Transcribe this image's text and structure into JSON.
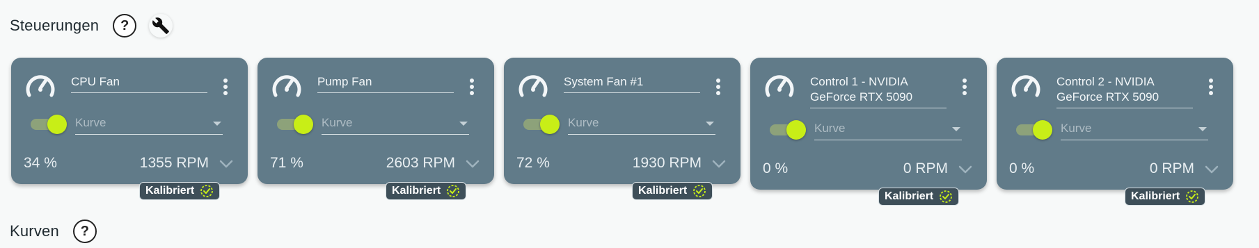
{
  "sections": {
    "controls_title": "Steuerungen",
    "curves_title": "Kurven"
  },
  "header_icons": {
    "help": "?",
    "help_icon_name": "help-icon",
    "tools_icon_name": "wrench-icon"
  },
  "cards": [
    {
      "name_line1": "CPU Fan",
      "name_line2": "",
      "curve_placeholder": "Kurve",
      "percent": "34 %",
      "rpm": "1355 RPM",
      "badge": "Kalibriert",
      "enabled": true
    },
    {
      "name_line1": "Pump Fan",
      "name_line2": "",
      "curve_placeholder": "Kurve",
      "percent": "71 %",
      "rpm": "2603 RPM",
      "badge": "Kalibriert",
      "enabled": true
    },
    {
      "name_line1": "System Fan #1",
      "name_line2": "",
      "curve_placeholder": "Kurve",
      "percent": "72 %",
      "rpm": "1930 RPM",
      "badge": "Kalibriert",
      "enabled": true
    },
    {
      "name_line1": "Control 1 - NVIDIA",
      "name_line2": "GeForce RTX 5090",
      "curve_placeholder": "Kurve",
      "percent": "0 %",
      "rpm": "0 RPM",
      "badge": "Kalibriert",
      "enabled": true
    },
    {
      "name_line1": "Control 2 - NVIDIA",
      "name_line2": "GeForce RTX 5090",
      "curve_placeholder": "Kurve",
      "percent": "0 %",
      "rpm": "0 RPM",
      "badge": "Kalibriert",
      "enabled": true
    }
  ],
  "colors": {
    "card_bg": "#617b89",
    "accent_green": "#c8ee17",
    "badge_bg": "#3e4f59"
  }
}
